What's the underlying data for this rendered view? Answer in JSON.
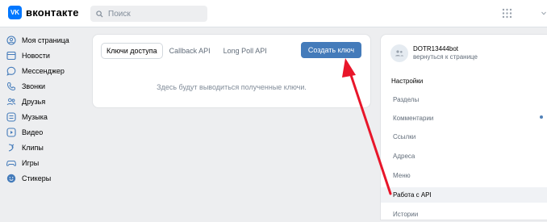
{
  "header": {
    "logo_text": "вконтакте",
    "logo_mark": "VK",
    "search_placeholder": "Поиск",
    "apps_icon": "grid-icon"
  },
  "sidebar": {
    "items": [
      {
        "label": "Моя страница",
        "icon": "user-circle-icon"
      },
      {
        "label": "Новости",
        "icon": "news-icon"
      },
      {
        "label": "Мессенджер",
        "icon": "message-icon"
      },
      {
        "label": "Звонки",
        "icon": "phone-icon"
      },
      {
        "label": "Друзья",
        "icon": "friends-icon"
      },
      {
        "label": "Музыка",
        "icon": "music-icon"
      },
      {
        "label": "Видео",
        "icon": "video-icon"
      },
      {
        "label": "Клипы",
        "icon": "clips-icon"
      },
      {
        "label": "Игры",
        "icon": "games-icon"
      },
      {
        "label": "Стикеры",
        "icon": "stickers-icon"
      }
    ]
  },
  "main": {
    "tabs": [
      "Ключи доступа",
      "Callback API",
      "Long Poll API"
    ],
    "create_button": "Создать ключ",
    "empty_message": "Здесь будут выводиться полученные ключи."
  },
  "right_panel": {
    "bot_name": "DOTR13444bot",
    "back_link": "вернуться к странице",
    "section_title": "Настройки",
    "menu": [
      {
        "label": "Разделы",
        "active": false
      },
      {
        "label": "Комментарии",
        "active": false,
        "has_dot": true
      },
      {
        "label": "Ссылки",
        "active": false
      },
      {
        "label": "Адреса",
        "active": false
      },
      {
        "label": "Меню",
        "active": false
      },
      {
        "label": "Работа с API",
        "active": true
      },
      {
        "label": "Истории",
        "active": false
      }
    ]
  },
  "annotation": {
    "arrow_color": "#e8162a"
  },
  "colors": {
    "accent": "#447bba",
    "brand": "#0077ff",
    "background": "#edeef0"
  }
}
